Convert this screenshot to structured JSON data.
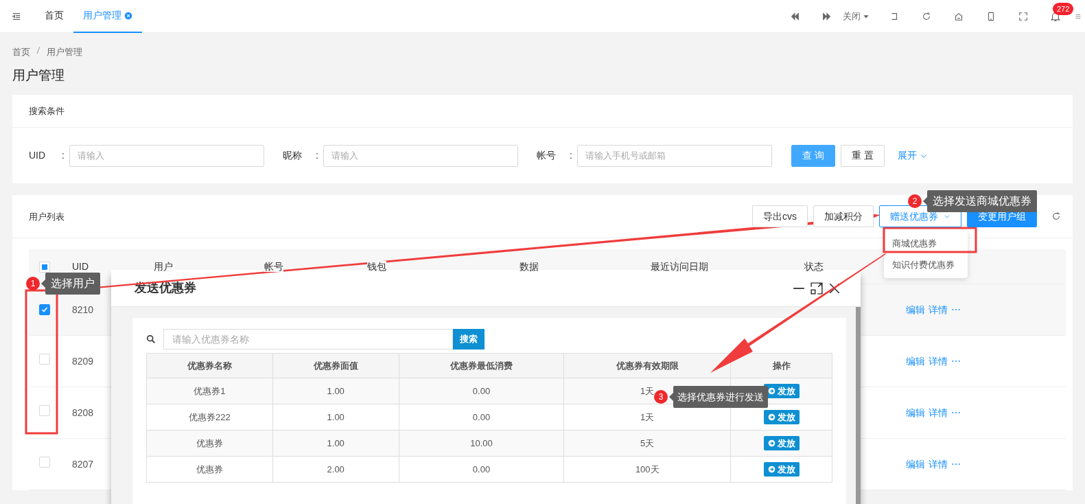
{
  "topbar": {
    "tabs": [
      {
        "label": "首页",
        "selected": false,
        "closable": false
      },
      {
        "label": "用户管理",
        "selected": true,
        "closable": true
      }
    ],
    "close_menu": "关闭",
    "notification_count": "272"
  },
  "breadcrumb": [
    "首页",
    "用户管理"
  ],
  "page_title": "用户管理",
  "search_panel": {
    "title": "搜索条件",
    "fields": [
      {
        "label": "UID",
        "colon": ":",
        "placeholder": "请输入"
      },
      {
        "label": "昵称",
        "colon": ":",
        "placeholder": "请输入"
      },
      {
        "label": "帐号",
        "colon": ":",
        "placeholder": "请输入手机号或邮箱"
      }
    ],
    "buttons": [
      {
        "label": "查 询",
        "kind": "primary"
      },
      {
        "label": "重 置",
        "kind": "default"
      }
    ],
    "expand_link": "展开"
  },
  "user_list": {
    "title": "用户列表",
    "actions": [
      {
        "label": "导出cvs",
        "kind": "default"
      },
      {
        "label": "加减积分",
        "kind": "default"
      },
      {
        "label": "赠送优惠券",
        "kind": "dropdown"
      },
      {
        "label": "变更用户组",
        "kind": "primary"
      }
    ],
    "select_all_partial": true,
    "columns": [
      "UID",
      "用户",
      "帐号",
      "钱包",
      "数据",
      "最近访问日期",
      "状态"
    ],
    "rows": [
      {
        "uid": "8210",
        "checked": true,
        "actions": [
          "编辑",
          "详情",
          "⋯"
        ]
      },
      {
        "uid": "8209",
        "checked": false,
        "actions": [
          "编辑",
          "详情",
          "⋯"
        ]
      },
      {
        "uid": "8208",
        "checked": false,
        "actions": [
          "编辑",
          "详情",
          "⋯"
        ]
      },
      {
        "uid": "8207",
        "checked": false,
        "actions": [
          "编辑",
          "详情",
          "⋯"
        ]
      }
    ]
  },
  "coupon_menu": {
    "items": [
      "商城优惠券",
      "知识付费优惠券"
    ]
  },
  "modal": {
    "title": "发送优惠券",
    "search_placeholder": "请输入优惠券名称",
    "search_button": "搜索",
    "columns": [
      "优惠券名称",
      "优惠券面值",
      "优惠券最低消费",
      "优惠券有效期限",
      "操作"
    ],
    "rows": [
      {
        "name": "优惠券1",
        "value": "1.00",
        "min_spend": "0.00",
        "validity": "1天",
        "action": "发放"
      },
      {
        "name": "优惠券222",
        "value": "1.00",
        "min_spend": "0.00",
        "validity": "1天",
        "action": "发放"
      },
      {
        "name": "优惠券",
        "value": "1.00",
        "min_spend": "10.00",
        "validity": "5天",
        "action": "发放"
      },
      {
        "name": "优惠券",
        "value": "2.00",
        "min_spend": "0.00",
        "validity": "100天",
        "action": "发放"
      }
    ]
  },
  "callouts": [
    {
      "number": "1",
      "text": "选择用户"
    },
    {
      "number": "2",
      "text": "选择发送商城优惠券"
    },
    {
      "number": "3",
      "text": "选择优惠券进行发送"
    }
  ]
}
